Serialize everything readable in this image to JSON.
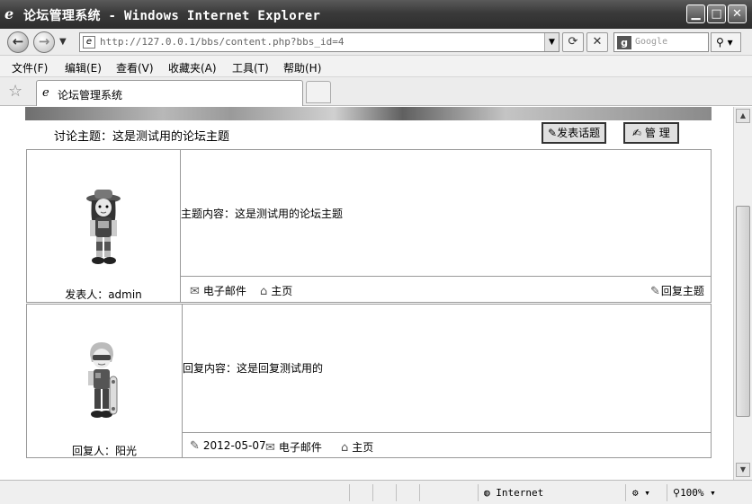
{
  "window": {
    "title": "论坛管理系统 - Windows Internet Explorer",
    "minimize_glyph": "▁",
    "maximize_glyph": "□",
    "close_glyph": "✕"
  },
  "address": {
    "url": "http://127.0.0.1/bbs/content.php?bbs_id=4",
    "search_placeholder": "Google",
    "back_glyph": "←",
    "forward_glyph": "→",
    "refresh_glyph": "⟳",
    "stop_glyph": "✕",
    "search_glyph": "⚲"
  },
  "menu": [
    "文件(F)",
    "编辑(E)",
    "查看(V)",
    "收藏夹(A)",
    "工具(T)",
    "帮助(H)"
  ],
  "tab": {
    "label": "论坛管理系统"
  },
  "page": {
    "topic_label": "讨论主题：这是测试用的论坛主题",
    "post_topic_button": "发表话题",
    "manage_button": "管 理"
  },
  "posts": [
    {
      "author_label": "发表人：admin",
      "content": "主题内容：这是测试用的论坛主题",
      "email": "电子邮件",
      "homepage": "主页",
      "reply": "回复主题"
    },
    {
      "author_label": "回复人：阳光",
      "content": "回复内容：这是回复测试用的",
      "date": "2012-05-07",
      "email": "电子邮件",
      "homepage": "主页"
    }
  ],
  "status": {
    "zone": "Internet",
    "zoom": "100%"
  },
  "icons": {
    "ie": "ie-logo-icon",
    "email": "email-icon",
    "home": "home-icon",
    "reply": "reply-icon",
    "date": "date-icon",
    "favorites": "star-icon",
    "globe": "globe-icon",
    "zoom": "magnifier-icon"
  }
}
